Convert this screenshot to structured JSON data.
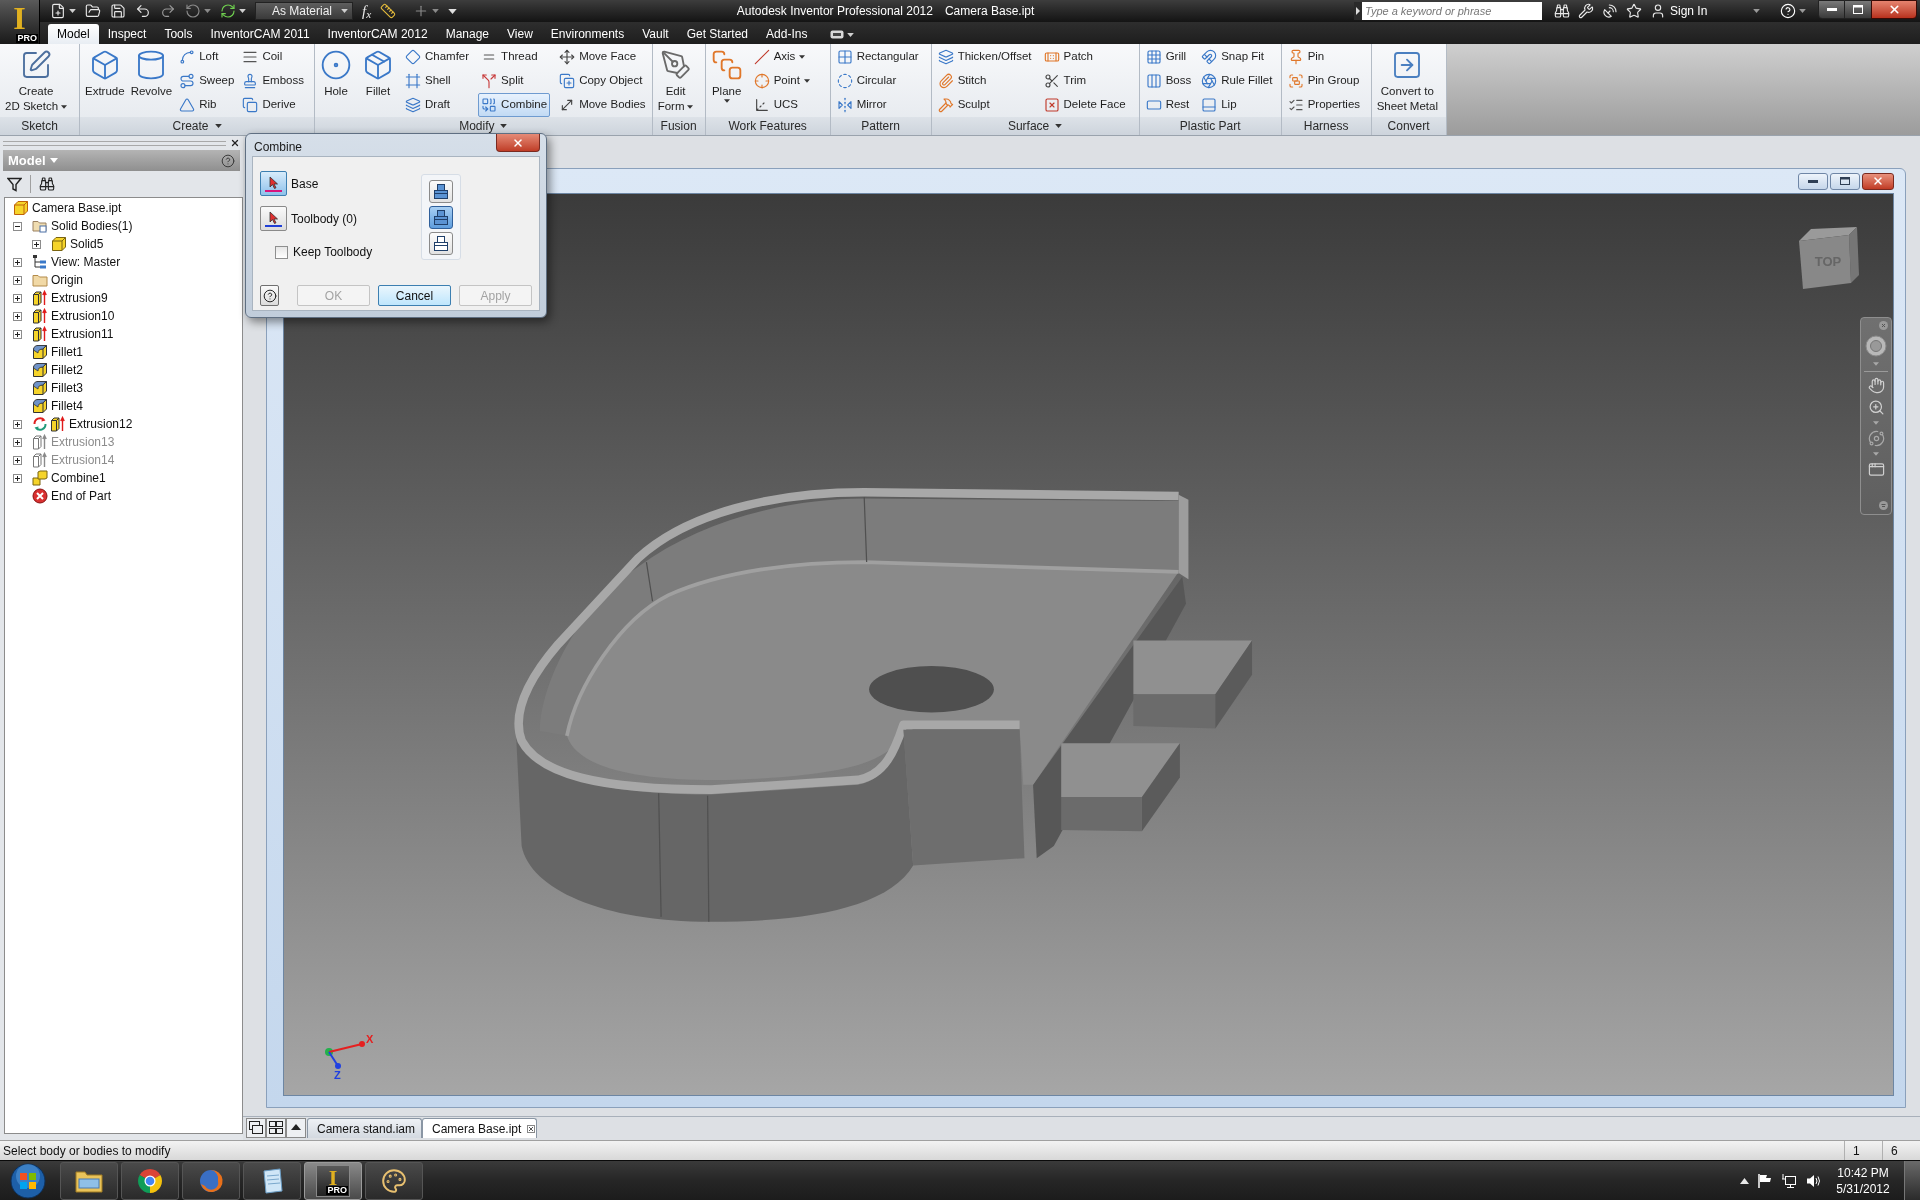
{
  "app_button": {
    "letter": "I",
    "badge": "PRO"
  },
  "quick_access": {
    "appearance": "As Material",
    "parameters_glyph": "f$_{x}$"
  },
  "title_bar": {
    "title": "Autodesk Inventor Professional 2012",
    "document": "Camera Base.ipt",
    "search": {
      "placeholder": "Type a keyword or phrase"
    },
    "sign_in": "Sign In"
  },
  "tabs": [
    {
      "label": "Model",
      "selected": true
    },
    {
      "label": "Inspect",
      "selected": false
    },
    {
      "label": "Tools",
      "selected": false
    },
    {
      "label": "InventorCAM 2011",
      "selected": false
    },
    {
      "label": "InventorCAM 2012",
      "selected": false
    },
    {
      "label": "Manage",
      "selected": false
    },
    {
      "label": "View",
      "selected": false
    },
    {
      "label": "Environments",
      "selected": false
    },
    {
      "label": "Vault",
      "selected": false
    },
    {
      "label": "Get Started",
      "selected": false
    },
    {
      "label": "Add-Ins",
      "selected": false
    }
  ],
  "ribbon": {
    "panels": [
      {
        "title": "Sketch",
        "menu": false,
        "large": [
          {
            "lines": [
              "Create",
              "2D Sketch"
            ],
            "dropdown": true,
            "selected": false
          }
        ]
      },
      {
        "title": "Create",
        "menu": true,
        "large": [
          {
            "lines": [
              "Extrude"
            ],
            "selected": false
          },
          {
            "lines": [
              "Revolve"
            ],
            "selected": false
          }
        ],
        "columns": [
          [
            {
              "label": "Loft",
              "selected": false
            },
            {
              "label": "Sweep",
              "selected": false
            },
            {
              "label": "Rib",
              "selected": false
            }
          ],
          [
            {
              "label": "Coil",
              "selected": false
            },
            {
              "label": "Emboss",
              "selected": false
            },
            {
              "label": "Derive",
              "selected": false
            }
          ]
        ]
      },
      {
        "title": "Modify",
        "menu": true,
        "large": [
          {
            "lines": [
              "Hole"
            ],
            "selected": false
          },
          {
            "lines": [
              "Fillet"
            ],
            "selected": false
          }
        ],
        "columns": [
          [
            {
              "label": "Chamfer",
              "selected": false
            },
            {
              "label": "Shell",
              "selected": false
            },
            {
              "label": "Draft",
              "selected": false
            }
          ],
          [
            {
              "label": "Thread",
              "selected": false
            },
            {
              "label": "Split",
              "selected": false
            },
            {
              "label": "Combine",
              "selected": true
            }
          ],
          [
            {
              "label": "Move Face",
              "selected": false
            },
            {
              "label": "Copy Object",
              "selected": false
            },
            {
              "label": "Move Bodies",
              "selected": false
            }
          ]
        ]
      },
      {
        "title": "Fusion",
        "menu": false,
        "large": [
          {
            "lines": [
              "Edit",
              "Form"
            ],
            "dropdown": true,
            "selected": false
          }
        ]
      },
      {
        "title": "Work Features",
        "menu": false,
        "large": [
          {
            "lines": [
              "Plane"
            ],
            "dropdown": true,
            "selected": false
          }
        ],
        "columns": [
          [
            {
              "label": "Axis",
              "dropdown": true,
              "selected": false
            },
            {
              "label": "Point",
              "dropdown": true,
              "selected": false
            },
            {
              "label": "UCS",
              "selected": false
            }
          ]
        ]
      },
      {
        "title": "Pattern",
        "menu": false,
        "columns": [
          [
            {
              "label": "Rectangular",
              "selected": false
            },
            {
              "label": "Circular",
              "selected": false
            },
            {
              "label": "Mirror",
              "selected": false
            }
          ]
        ]
      },
      {
        "title": "Surface",
        "menu": true,
        "columns": [
          [
            {
              "label": "Thicken/Offset",
              "selected": false
            },
            {
              "label": "Stitch",
              "selected": false
            },
            {
              "label": "Sculpt",
              "selected": false
            }
          ],
          [
            {
              "label": "Patch",
              "selected": false
            },
            {
              "label": "Trim",
              "selected": false
            },
            {
              "label": "Delete Face",
              "selected": false
            }
          ]
        ]
      },
      {
        "title": "Plastic Part",
        "menu": false,
        "columns": [
          [
            {
              "label": "Grill",
              "selected": false
            },
            {
              "label": "Boss",
              "selected": false
            },
            {
              "label": "Rest",
              "selected": false
            }
          ],
          [
            {
              "label": "Snap Fit",
              "selected": false
            },
            {
              "label": "Rule Fillet",
              "selected": false
            },
            {
              "label": "Lip",
              "selected": false
            }
          ]
        ]
      },
      {
        "title": "Harness",
        "menu": false,
        "columns": [
          [
            {
              "label": "Pin",
              "selected": false
            },
            {
              "label": "Pin Group",
              "selected": false
            },
            {
              "label": "Properties",
              "selected": false
            }
          ]
        ]
      },
      {
        "title": "Convert",
        "menu": false,
        "large": [
          {
            "lines": [
              "Convert to",
              "Sheet Metal"
            ],
            "selected": false
          }
        ]
      }
    ]
  },
  "browser": {
    "title": "Model",
    "tree": {
      "label": "Camera Base.ipt",
      "kind": "part",
      "children": [
        {
          "label": "Solid Bodies(1)",
          "kind": "bodies",
          "expanded": true,
          "suppressed": false,
          "needs_update": false,
          "children": [
            {
              "label": "Solid5",
              "kind": "body",
              "expanded": false,
              "suppressed": false,
              "needs_update": false
            }
          ]
        },
        {
          "label": "View: Master",
          "kind": "view",
          "expanded": false,
          "suppressed": false,
          "needs_update": false
        },
        {
          "label": "Origin",
          "kind": "folder",
          "expanded": false,
          "suppressed": false,
          "needs_update": false
        },
        {
          "label": "Extrusion9",
          "kind": "extrusion",
          "expanded": false,
          "suppressed": false,
          "needs_update": false
        },
        {
          "label": "Extrusion10",
          "kind": "extrusion",
          "expanded": false,
          "suppressed": false,
          "needs_update": false
        },
        {
          "label": "Extrusion11",
          "kind": "extrusion",
          "expanded": false,
          "suppressed": false,
          "needs_update": false
        },
        {
          "label": "Fillet1",
          "kind": "fillet",
          "suppressed": false,
          "needs_update": false
        },
        {
          "label": "Fillet2",
          "kind": "fillet",
          "suppressed": false,
          "needs_update": false
        },
        {
          "label": "Fillet3",
          "kind": "fillet",
          "suppressed": false,
          "needs_update": false
        },
        {
          "label": "Fillet4",
          "kind": "fillet",
          "suppressed": false,
          "needs_update": false
        },
        {
          "label": "Extrusion12",
          "kind": "extrusion",
          "expanded": false,
          "suppressed": false,
          "needs_update": true
        },
        {
          "label": "Extrusion13",
          "kind": "extrusion",
          "expanded": false,
          "suppressed": true,
          "needs_update": false
        },
        {
          "label": "Extrusion14",
          "kind": "extrusion",
          "expanded": false,
          "suppressed": true,
          "needs_update": false
        },
        {
          "label": "Combine1",
          "kind": "combine",
          "expanded": false,
          "suppressed": false,
          "needs_update": false
        },
        {
          "label": "End of Part",
          "kind": "end",
          "suppressed": false,
          "needs_update": false
        }
      ]
    }
  },
  "dialog": {
    "title": "Combine",
    "selectors": [
      {
        "label": "Base",
        "selected": true,
        "color": "#d8147e"
      },
      {
        "label": "Toolbody (0)",
        "selected": false,
        "color": "#1f3fd6"
      }
    ],
    "keep_toolbody": {
      "label": "Keep Toolbody",
      "checked": false
    },
    "operations": [
      {
        "selected": false
      },
      {
        "selected": true
      },
      {
        "selected": false
      }
    ],
    "buttons": [
      {
        "label": "OK",
        "disabled": true,
        "default": false
      },
      {
        "label": "Cancel",
        "disabled": false,
        "default": true
      },
      {
        "label": "Apply",
        "disabled": true,
        "default": false
      }
    ]
  },
  "viewport": {
    "viewcube": {
      "label": "TOP"
    },
    "axes": [
      {
        "label": "X",
        "color": "#e52020"
      },
      {
        "label": "Z",
        "color": "#2040e0"
      }
    ]
  },
  "document_tabs": [
    {
      "label": "Camera stand.iam",
      "selected": false
    },
    {
      "label": "Camera Base.ipt",
      "selected": true
    }
  ],
  "status_bar": {
    "message": "Select body or bodies to modify",
    "fields": [
      "1",
      "6"
    ]
  },
  "taskbar": {
    "apps": [
      {
        "selected": false
      },
      {
        "selected": false
      },
      {
        "selected": false
      },
      {
        "selected": false
      },
      {
        "selected": true,
        "letter": "I",
        "badge": "PRO"
      },
      {
        "selected": false
      }
    ],
    "clock": {
      "time": "10:42 PM",
      "date": "5/31/2012"
    }
  }
}
